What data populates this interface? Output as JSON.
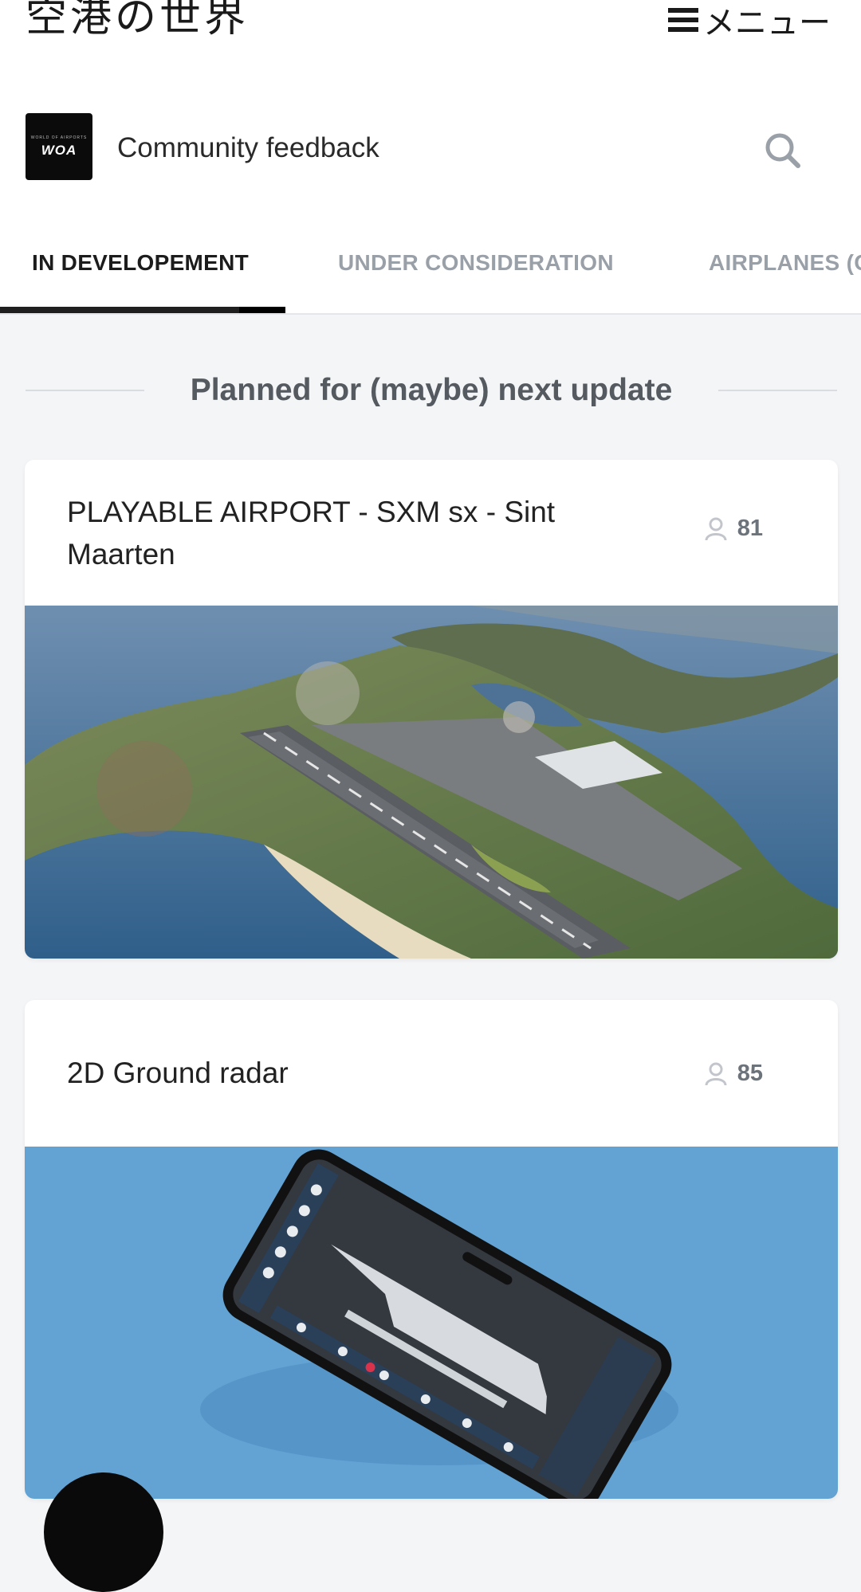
{
  "site": {
    "title": "空港の世界",
    "menu_label": "メニュー"
  },
  "board": {
    "logo_text": "WOA",
    "logo_subtext": "WORLD OF AIRPORTS",
    "title": "Community feedback"
  },
  "tabs": [
    {
      "label": "IN DEVELOPEMENT",
      "active": true
    },
    {
      "label": "UNDER CONSIDERATION",
      "active": false
    },
    {
      "label": "AIRPLANES (C",
      "active": false
    }
  ],
  "section": {
    "heading": "Planned for (maybe) next update"
  },
  "posts": [
    {
      "title_line1": "PLAYABLE AIRPORT - SXM sx - Sint",
      "title_line2": "Maarten",
      "votes": "81",
      "image": "aerial-airport-island-image"
    },
    {
      "title": "2D Ground radar",
      "votes": "85",
      "image": "phone-ground-radar-image"
    }
  ],
  "colors": {
    "background": "#f4f5f7",
    "card": "#ffffff",
    "tab_active": "#1c1c1c",
    "tab_inactive": "#9aa0a8",
    "radar_bg": "#62a3d4"
  }
}
